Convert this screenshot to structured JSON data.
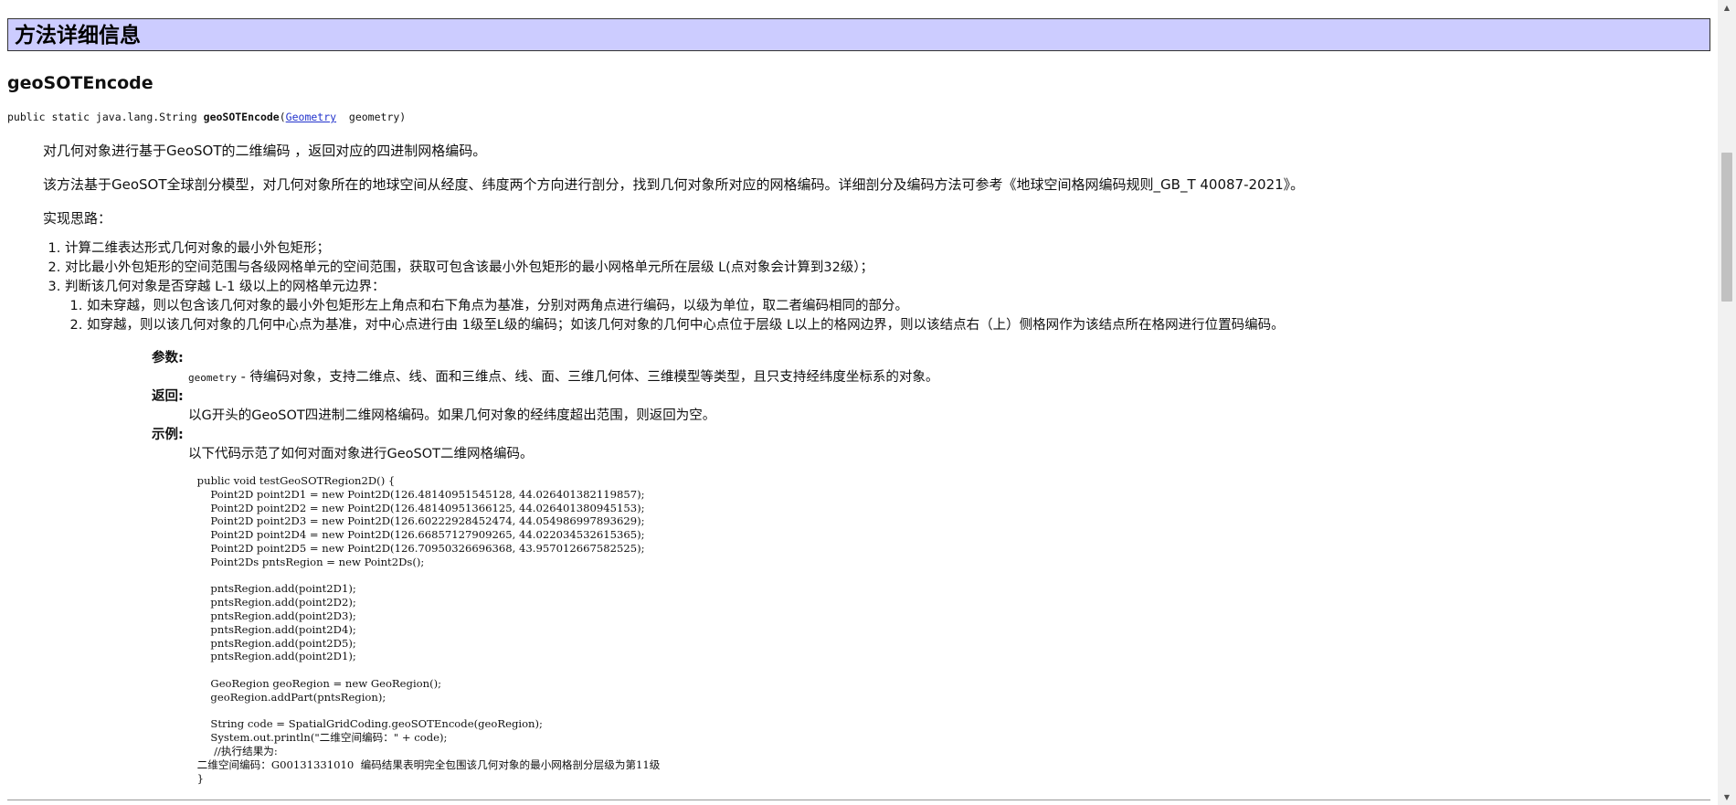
{
  "header": {
    "title": "方法详细信息"
  },
  "method": {
    "name": "geoSOTEncode",
    "signature": {
      "prefix": "public static java.lang.String ",
      "name": "geoSOTEncode",
      "open": "(",
      "param_type": "Geometry",
      "param_rest": "  geometry)"
    }
  },
  "description": {
    "summary": "对几何对象进行基于GeoSOT的二维编码 ，返回对应的四进制网格编码。",
    "detail": "该方法基于GeoSOT全球剖分模型，对几何对象所在的地球空间从经度、纬度两个方向进行剖分，找到几何对象所对应的网格编码。详细剖分及编码方法可参考《地球空间格网编码规则_GB_T 40087-2021》。",
    "approach_label": "实现思路："
  },
  "steps": [
    "计算二维表达形式几何对象的最小外包矩形；",
    "对比最小外包矩形的空间范围与各级网格单元的空间范围，获取可包含该最小外包矩形的最小网格单元所在层级 L(点对象会计算到32级）；",
    "判断该几何对象是否穿越 L-1 级以上的网格单元边界："
  ],
  "sub_steps": [
    "如未穿越，则以包含该几何对象的最小外包矩形左上角点和右下角点为基准，分别对两角点进行编码，以级为单位，取二者编码相同的部分。",
    "如穿越，则以该几何对象的几何中心点为基准，对中心点进行由 1级至L级的编码；如该几何对象的几何中心点位于层级 L以上的格网边界，则以该结点右（上）侧格网作为该结点所在格网进行位置码编码。"
  ],
  "details": {
    "params_label": "参数:",
    "param_name": "geometry",
    "param_desc": " - 待编码对象，支持二维点、线、面和三维点、线、面、三维几何体、三维模型等类型，且只支持经纬度坐标系的对象。",
    "returns_label": "返回:",
    "returns_desc": "以G开头的GeoSOT四进制二维网格编码。如果几何对象的经纬度超出范围，则返回为空。",
    "example_label": "示例:",
    "example_desc": "以下代码示范了如何对面对象进行GeoSOT二维网格编码。"
  },
  "code_example": " public void testGeoSOTRegion2D() {\n     Point2D point2D1 = new Point2D(126.48140951545128, 44.026401382119857);\n     Point2D point2D2 = new Point2D(126.48140951366125, 44.026401380945153);\n     Point2D point2D3 = new Point2D(126.60222928452474, 44.054986997893629);\n     Point2D point2D4 = new Point2D(126.66857127909265, 44.022034532615365);\n     Point2D point2D5 = new Point2D(126.70950326696368, 43.957012667582525);\n     Point2Ds pntsRegion = new Point2Ds();\n\n     pntsRegion.add(point2D1);\n     pntsRegion.add(point2D2);\n     pntsRegion.add(point2D3);\n     pntsRegion.add(point2D4);\n     pntsRegion.add(point2D5);\n     pntsRegion.add(point2D1);\n\n     GeoRegion geoRegion = new GeoRegion();\n     geoRegion.addPart(pntsRegion);\n\n     String code = SpatialGridCoding.geoSOTEncode(geoRegion);\n     System.out.println(\"二维空间编码：\" + code);\n      //执行结果为:\n 二维空间编码：G00131331010  编码结果表明完全包围该几何对象的最小网格剖分层级为第11级\n }"
}
